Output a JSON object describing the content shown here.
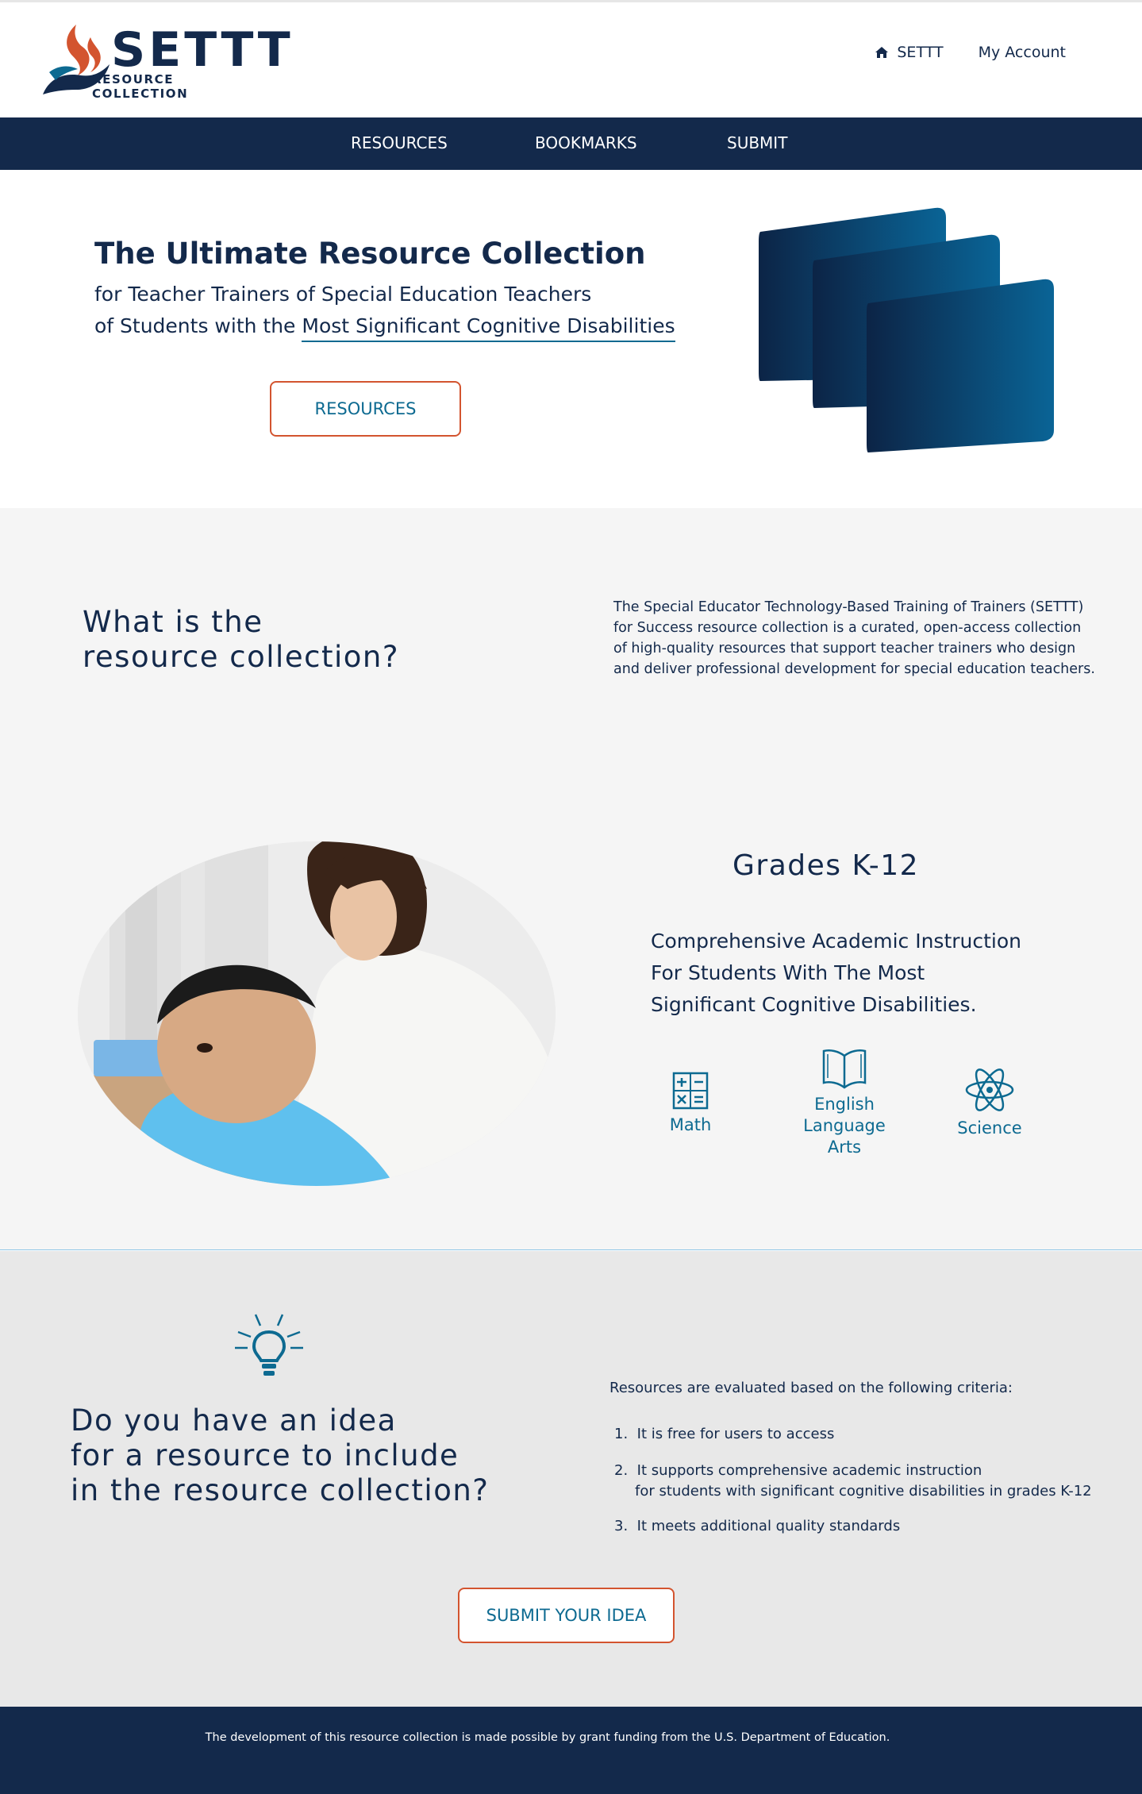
{
  "header": {
    "logo_word": "SETTT",
    "logo_sub": "RESOURCE COLLECTION",
    "home_label": "SETTT",
    "account_label": "My Account"
  },
  "nav": {
    "items": [
      {
        "label": "RESOURCES"
      },
      {
        "label": "BOOKMARKS"
      },
      {
        "label": "SUBMIT"
      }
    ]
  },
  "hero": {
    "title": "The Ultimate Resource Collection",
    "line1": "for Teacher Trainers of Special Education Teachers",
    "line2_prefix": "of Students with the ",
    "line2_link": "Most Significant Cognitive  Disabilities",
    "button": "RESOURCES"
  },
  "what": {
    "title_l1": "What is the",
    "title_l2": "resource collection?",
    "text": "The Special Educator Technology-Based Training of Trainers (SETTT) for Success resource collection is a curated, open-access collection of high-quality resources that support teacher trainers who design and deliver professional development for special education teachers."
  },
  "grades": {
    "title": "Grades K-12",
    "desc_l1": "Comprehensive Academic Instruction",
    "desc_l2": "For Students With The Most",
    "desc_l3": "Significant Cognitive Disabilities.",
    "subjects": [
      {
        "label": "Math",
        "icon": "calculator-icon"
      },
      {
        "label_l1": "English",
        "label_l2": "Language",
        "label_l3": "Arts",
        "icon": "book-icon"
      },
      {
        "label": "Science",
        "icon": "atom-icon"
      }
    ]
  },
  "idea": {
    "title_l1": "Do you have an idea",
    "title_l2": "for a resource to include",
    "title_l3": "in the resource collection?",
    "criteria_intro": "Resources are  evaluated based on the following criteria:",
    "criteria": [
      {
        "num": "1.",
        "text": "It is free for users to access"
      },
      {
        "num": "2.",
        "text_l1": "It supports comprehensive academic instruction",
        "text_l2": "for students with significant cognitive disabilities in grades K-12"
      },
      {
        "num": "3.",
        "text": "It meets additional quality standards"
      }
    ],
    "button": "SUBMIT YOUR IDEA"
  },
  "footer": {
    "text": "The development of this resource collection is made possible by grant funding from the U.S. Department of Education."
  },
  "colors": {
    "navy": "#13294b",
    "teal": "#0d6a91",
    "accent_orange": "#d3542f",
    "section_gray": "#f5f5f5",
    "idea_gray": "#e8e8e8"
  }
}
